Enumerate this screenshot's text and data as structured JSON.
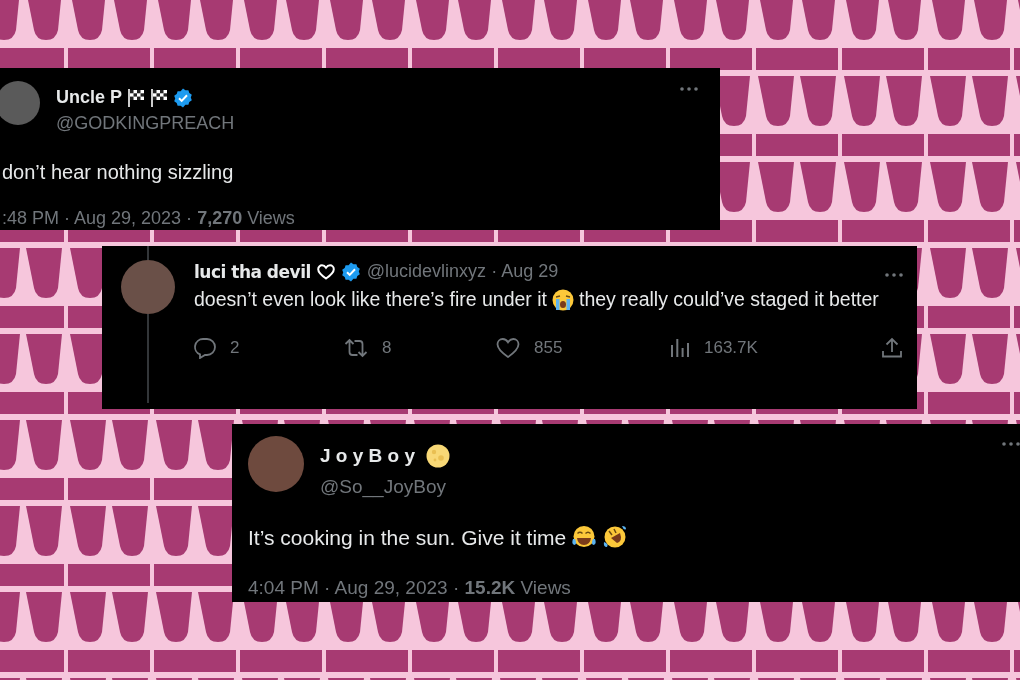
{
  "tweets": [
    {
      "kind": "main",
      "author": {
        "name": "Uncle P",
        "badges": [
          {
            "kind": "flag"
          },
          {
            "kind": "flag"
          },
          {
            "kind": "verified"
          }
        ],
        "handle": "@GODKINGPREACH"
      },
      "body": [
        {
          "kind": "text",
          "text": "don’t hear nothing sizzling"
        }
      ],
      "meta": ":48 PM · Aug 29, 2023 · **7,270** Views"
    },
    {
      "kind": "reply",
      "author": {
        "name": "luci tha devil",
        "badges": [
          {
            "kind": "heart"
          },
          {
            "kind": "verified"
          }
        ],
        "handle": "@lucidevlinxyz · Aug 29"
      },
      "body": [
        {
          "kind": "text",
          "text": "doesn’t even look like there’s fire under it"
        },
        {
          "kind": "crying-emoji"
        },
        {
          "kind": "text",
          "text": "they really could’ve staged it"
        },
        {
          "kind": "text",
          "text": "better"
        }
      ],
      "actions": [
        {
          "kind": "reply",
          "count": "2"
        },
        {
          "kind": "retweet",
          "count": "8"
        },
        {
          "kind": "like",
          "count": "855"
        },
        {
          "kind": "views",
          "count": "163.7K"
        },
        {
          "kind": "share"
        }
      ]
    },
    {
      "kind": "main",
      "author": {
        "name": "J o y B o y",
        "badges": [
          {
            "kind": "moon"
          }
        ],
        "handle": "@So__JoyBoy"
      },
      "body": [
        {
          "kind": "text",
          "text": "It’s cooking in the sun. Give it time"
        },
        {
          "kind": "joy-emoji"
        },
        {
          "kind": "rofl-emoji"
        }
      ],
      "meta": "4:04 PM · Aug 29, 2023 · **15.2K** Views"
    }
  ]
}
